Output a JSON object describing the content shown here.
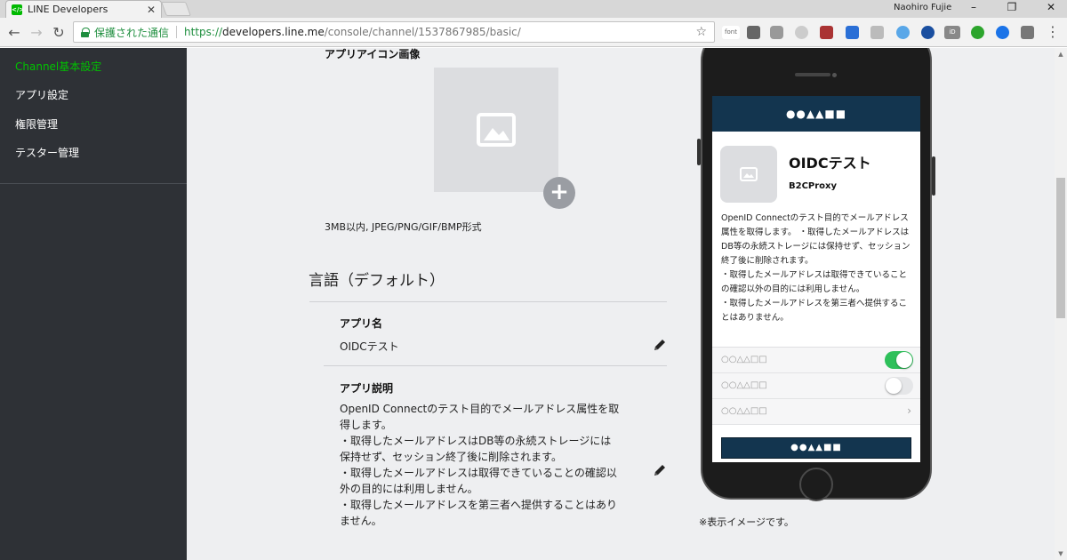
{
  "browser": {
    "tab_title": "LINE Developers",
    "tab_favicon_text": "</>",
    "profile_name": "Naohiro Fujie",
    "secure_label": "保護された通信",
    "url_protocol": "https://",
    "url_host": "developers.line.me",
    "url_path": "/console/channel/1537867985/basic/",
    "extensions_text": [
      "font",
      "iD"
    ]
  },
  "sidebar": {
    "items": [
      {
        "label": "Channel基本設定",
        "active": true
      },
      {
        "label": "アプリ設定",
        "active": false
      },
      {
        "label": "権限管理",
        "active": false
      },
      {
        "label": "テスター管理",
        "active": false
      }
    ]
  },
  "main": {
    "app_icon_label": "アプリアイコン画像",
    "icon_format_note": "3MB以内, JPEG/PNG/GIF/BMP形式",
    "language_section_title": "言語（デフォルト）",
    "app_name_label": "アプリ名",
    "app_name_value": "OIDCテスト",
    "app_desc_label": "アプリ説明",
    "app_desc_lines": [
      "OpenID Connectのテスト目的でメールアドレス属性を取得します。",
      "・取得したメールアドレスはDB等の永続ストレージには保持せず、セッション終了後に削除されます。",
      "・取得したメールアドレスは取得できていることの確認以外の目的には利用しません。",
      "・取得したメールアドレスを第三者へ提供することはありません。"
    ]
  },
  "preview": {
    "header_text": "●●▲▲■■",
    "app_name": "OIDCテスト",
    "provider": "B2CProxy",
    "desc_lines": [
      "OpenID Connectのテスト目的でメールアドレス属性を取得します。 ・取得したメールアドレスはDB等の永続ストレージには保持せず、セッション終了後に削除されます。",
      "・取得したメールアドレスは取得できていることの確認以外の目的には利用しません。",
      "・取得したメールアドレスを第三者へ提供することはありません。"
    ],
    "rows": [
      {
        "label": "○○△△□□",
        "control": "toggle-on"
      },
      {
        "label": "○○△△□□",
        "control": "toggle-off"
      },
      {
        "label": "○○△△□□",
        "control": "chevron"
      }
    ],
    "button_text": "●●▲▲■■",
    "note": "※表示イメージです。"
  },
  "colors": {
    "sidebar_bg": "#2e3136",
    "sidebar_active": "#00c300",
    "content_bg": "#eeeff1",
    "preview_header": "#13354f",
    "toggle_on": "#2ec05a"
  }
}
